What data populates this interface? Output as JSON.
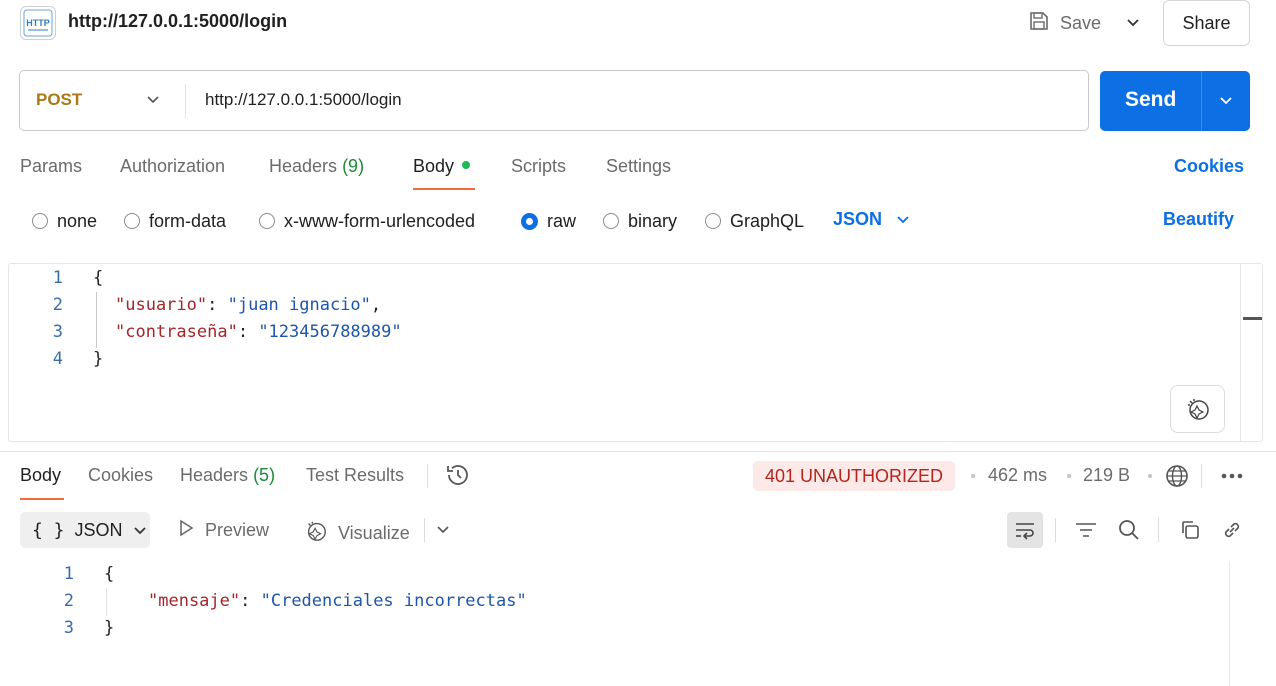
{
  "header": {
    "icon_text": "HTTP",
    "title": "http://127.0.0.1:5000/login",
    "save_label": "Save",
    "share_label": "Share"
  },
  "request": {
    "method": "POST",
    "url": "http://127.0.0.1:5000/login",
    "send_label": "Send"
  },
  "request_tabs": {
    "params": "Params",
    "authorization": "Authorization",
    "headers": "Headers",
    "headers_count": "(9)",
    "body": "Body",
    "scripts": "Scripts",
    "settings": "Settings",
    "cookies": "Cookies"
  },
  "body_types": {
    "none": "none",
    "form_data": "form-data",
    "urlencoded": "x-www-form-urlencoded",
    "raw": "raw",
    "binary": "binary",
    "graphql": "GraphQL",
    "selected": "raw",
    "format": "JSON",
    "beautify": "Beautify"
  },
  "request_body": {
    "line_numbers": [
      "1",
      "2",
      "3",
      "4"
    ],
    "open_brace": "{",
    "close_brace": "}",
    "key1": "\"usuario\"",
    "val1": "\"juan ignacio\"",
    "key2": "\"contraseña\"",
    "val2": "\"123456788989\""
  },
  "response_tabs": {
    "body": "Body",
    "cookies": "Cookies",
    "headers": "Headers",
    "headers_count": "(5)",
    "test_results": "Test Results"
  },
  "response_meta": {
    "status": "401 UNAUTHORIZED",
    "time": "462 ms",
    "size": "219 B"
  },
  "response_toolbar": {
    "format_braces": "{ }",
    "format": "JSON",
    "preview": "Preview",
    "visualize": "Visualize"
  },
  "response_body": {
    "line_numbers": [
      "1",
      "2",
      "3"
    ],
    "open_brace": "{",
    "close_brace": "}",
    "key1": "\"mensaje\"",
    "val1": "\"Credenciales incorrectas\""
  },
  "colors": {
    "accent": "#0c6fe4",
    "method": "#a97a16",
    "active_tab_underline": "#f26b3a",
    "error_badge_bg": "#fde9e7",
    "error_badge_text": "#b3261e",
    "json_key": "#a3262b",
    "json_string": "#1e56a8"
  }
}
